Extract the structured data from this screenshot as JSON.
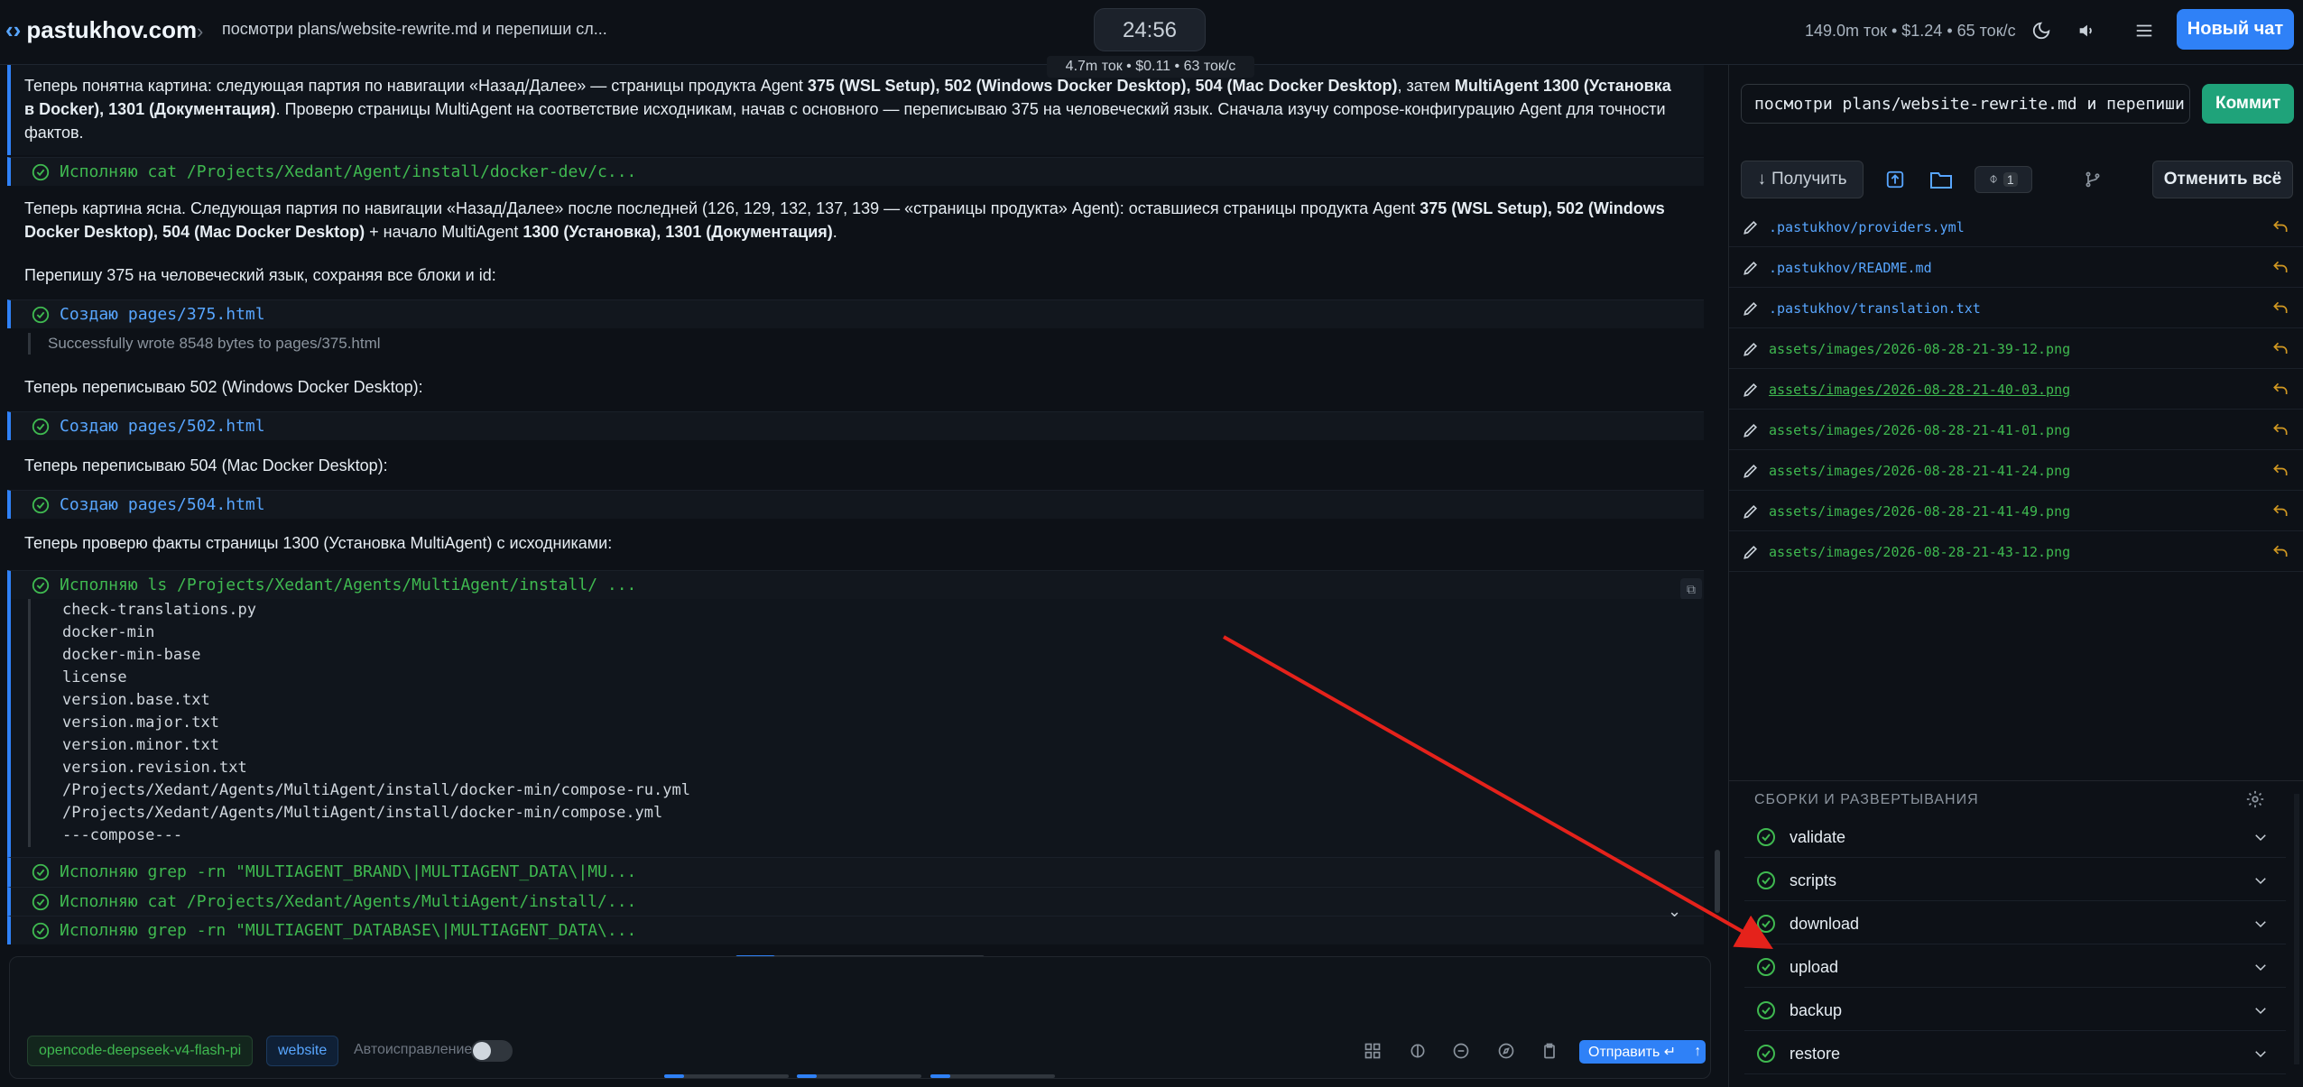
{
  "header": {
    "site": "pastukhov.com",
    "breadcrumb": "посмотри plans/website-rewrite.md и перепиши сл...",
    "timer": "24:56",
    "sub_stats": "4.7m ток • $0.11 • 63 ток/с",
    "stats": "149.0m ток • $1.24 • 65 ток/с",
    "new_chat": "Новый чат"
  },
  "chat": {
    "p1_a": "Теперь понятна картина: следующая партия по навигации «Назад/Далее» — страницы продукта Agent ",
    "p1_b1": "375 (WSL Setup), 502 (Windows Docker Desktop), 504 (Mac Docker Desktop)",
    "p1_c": ", затем ",
    "p1_b2": "MultiAgent 1300 (Установка в Docker), 1301 (Документация)",
    "p1_d": ". Проверю страницы MultiAgent на соответствие исходникам, начав с основного — переписываю 375 на человеческий язык. Сначала изучу compose-конфигурацию Agent для точности фактов.",
    "tool1": "Исполняю cat /Projects/Xedant/Agent/install/docker-dev/c...",
    "p2_a": "Теперь картина ясна. Следующая партия по навигации «Назад/Далее» после последней (126, 129, 132, 137, 139 — «страницы продукта» Agent): оставшиеся страницы продукта Agent ",
    "p2_b1": "375 (WSL Setup), 502 (Windows Docker Desktop), 504 (Mac Docker Desktop)",
    "p2_c": " + начало MultiAgent ",
    "p2_b2": "1300 (Установка), 1301 (Документация)",
    "p2_d": ".",
    "p3": "Перепишу 375 на человеческий язык, сохраняя все блоки и id:",
    "tool2": "Создаю pages/375.html",
    "tool2_out": "Successfully wrote 8548 bytes to pages/375.html",
    "p4": "Теперь переписываю 502 (Windows Docker Desktop):",
    "tool3": "Создаю pages/502.html",
    "p5": "Теперь переписываю 504 (Mac Docker Desktop):",
    "tool4": "Создаю pages/504.html",
    "p6": "Теперь проверю факты страницы 1300 (Установка MultiAgent) с исходниками:",
    "tool5": "Исполняю ls /Projects/Xedant/Agents/MultiAgent/install/ ...",
    "ls_output": [
      "check-translations.py",
      "docker-min",
      "docker-min-base",
      "license",
      "version.base.txt",
      "version.major.txt",
      "version.minor.txt",
      "version.revision.txt",
      "/Projects/Xedant/Agents/MultiAgent/install/docker-min/compose-ru.yml",
      "/Projects/Xedant/Agents/MultiAgent/install/docker-min/compose.yml",
      "---compose---"
    ],
    "tool6": "Исполняю grep -rn \"MULTIAGENT_BRAND\\|MULTIAGENT_DATA\\|MU...",
    "tool7": "Исполняю cat /Projects/Xedant/Agents/MultiAgent/install/...",
    "tool8": "Исполняю grep -rn \"MULTIAGENT_DATABASE\\|MULTIAGENT_DATA\\..."
  },
  "composer": {
    "model_chip": "opencode-deepseek-v4-flash-pi",
    "project_chip": "website",
    "autofix_label": "Автоисправление",
    "autofix_on": false,
    "send_label": "Отправить ↵"
  },
  "git": {
    "commit_message": "посмотри plans/website-rewrite.md и перепиши",
    "commit_label": "Коммит",
    "fetch_label": "Получить",
    "commit_count": "1",
    "revert_all_label": "Отменить всё",
    "files": [
      {
        "name": ".pastukhov/providers.yml",
        "color": "blue"
      },
      {
        "name": ".pastukhov/README.md",
        "color": "blue"
      },
      {
        "name": ".pastukhov/translation.txt",
        "color": "blue"
      },
      {
        "name": "assets/images/2026-08-28-21-39-12.png",
        "color": "green"
      },
      {
        "name": "assets/images/2026-08-28-21-40-03.png",
        "color": "green"
      },
      {
        "name": "assets/images/2026-08-28-21-41-01.png",
        "color": "green"
      },
      {
        "name": "assets/images/2026-08-28-21-41-24.png",
        "color": "green"
      },
      {
        "name": "assets/images/2026-08-28-21-41-49.png",
        "color": "green"
      },
      {
        "name": "assets/images/2026-08-28-21-43-12.png",
        "color": "green"
      }
    ]
  },
  "builds": {
    "title": "СБОРКИ И РАЗВЕРТЫВАНИЯ",
    "items": [
      "validate",
      "scripts",
      "download",
      "upload",
      "backup",
      "restore"
    ]
  },
  "colors": {
    "accent": "#2f81f7",
    "success": "#3fb950",
    "commit": "#1fa37a",
    "undo": "#d29922",
    "annotation_arrow": "#e5221b"
  }
}
